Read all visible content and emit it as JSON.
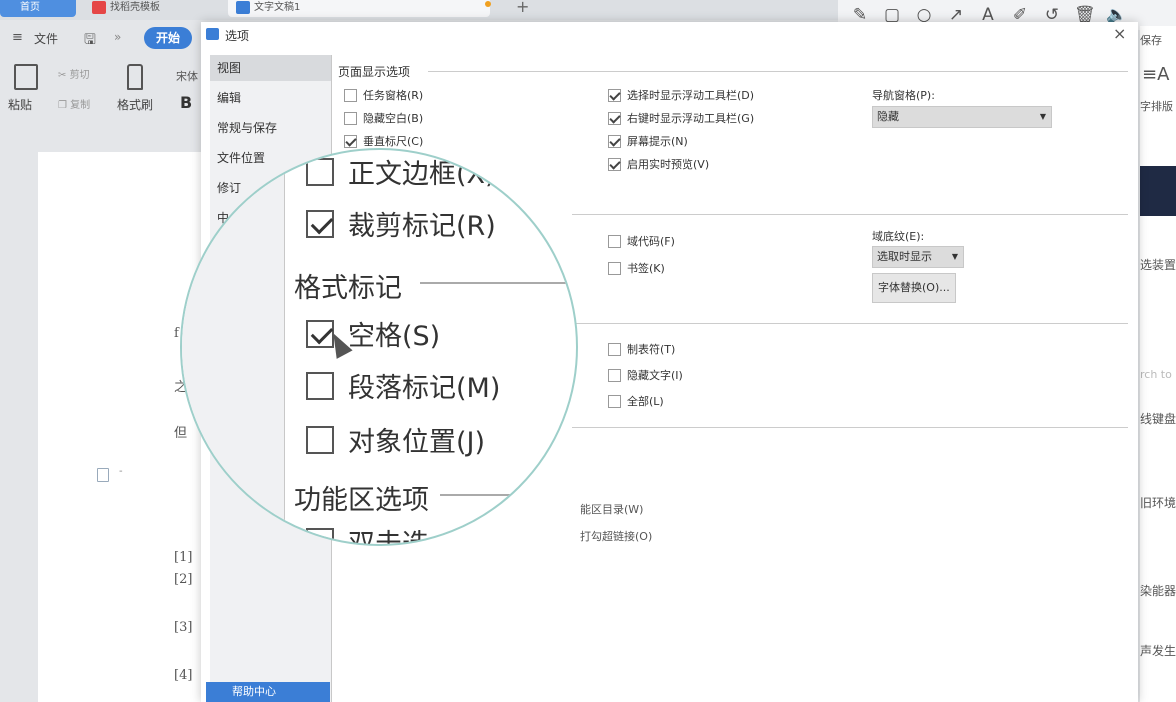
{
  "tabs": {
    "home": "首页",
    "template": "找稻壳模板",
    "doc": "文字文稿1"
  },
  "annotation_tools": [
    {
      "icon": "pencil-icon",
      "glyph": "✎"
    },
    {
      "icon": "rectangle-icon",
      "glyph": "▢"
    },
    {
      "icon": "circle-icon",
      "glyph": "○"
    },
    {
      "icon": "arrow-icon",
      "glyph": "↗"
    },
    {
      "icon": "text-icon",
      "glyph": "A"
    },
    {
      "icon": "marker-icon",
      "glyph": "✐"
    },
    {
      "icon": "undo-icon",
      "glyph": "↺"
    },
    {
      "icon": "trash-icon",
      "glyph": "🗑"
    },
    {
      "icon": "speaker-icon",
      "glyph": "🔈"
    }
  ],
  "menubar": {
    "hamburger": "≡",
    "file": "文件",
    "save_icon": "🖫",
    "more": "»",
    "start": "开始"
  },
  "ribbon": {
    "paste": "粘贴",
    "cut": "剪切",
    "copy": "复制",
    "format_painter": "格式刷",
    "font": "宋体",
    "bold": "B"
  },
  "right_strip": {
    "save": "保存",
    "char_layout_icon": "≡A",
    "char_layout": "字排版",
    "text1": "选装置",
    "search": "rch to",
    "text2": "线键盘",
    "text3": "旧环境",
    "text4": "染能器",
    "text5": "声发生"
  },
  "document": {
    "t1": "f",
    "t2": "之",
    "t3": "但",
    "refs": [
      "[1]",
      "[2]",
      "[3]",
      "[4]"
    ],
    "dash": "-"
  },
  "dialog": {
    "title": "选项",
    "close": "×",
    "nav": [
      "视图",
      "编辑",
      "常规与保存",
      "文件位置",
      "修订",
      "中"
    ],
    "help": "帮助中心",
    "page_section": "页面显示选项",
    "col1": [
      {
        "label": "任务窗格(R)",
        "checked": false
      },
      {
        "label": "隐藏空白(B)",
        "checked": false
      },
      {
        "label": "垂直标尺(C)",
        "checked": true
      }
    ],
    "col2": [
      {
        "label": "选择时显示浮动工具栏(D)",
        "checked": true
      },
      {
        "label": "右键时显示浮动工具栏(G)",
        "checked": true
      },
      {
        "label": "屏幕提示(N)",
        "checked": true
      },
      {
        "label": "启用实时预览(V)",
        "checked": true
      }
    ],
    "nav_pane_label": "导航窗格(P):",
    "nav_pane_value": "隐藏",
    "mid_col": [
      {
        "label": "域代码(F)",
        "checked": false
      },
      {
        "label": "书签(K)",
        "checked": false
      }
    ],
    "field_shading_label": "域底纹(E):",
    "field_shading_value": "选取时显示",
    "font_substitution": "字体替换(O)...",
    "format_col": [
      {
        "label": "制表符(T)",
        "checked": false
      },
      {
        "label": "隐藏文字(I)",
        "checked": false
      },
      {
        "label": "全部(L)",
        "checked": false
      }
    ],
    "ribbon_opt1": "双击选项卡时隐藏功能区目录(W)",
    "ribbon_opt2": "单击方框时打勾超链接(O)",
    "ribbon_opt1_visible": "能区目录(W)",
    "ribbon_opt2_visible": "打勾超链接(O)"
  },
  "magnifier": {
    "items": [
      {
        "label": "正文边框(X)",
        "checked": false
      },
      {
        "label": "裁剪标记(R)",
        "checked": true
      },
      {
        "label": "空格(S)",
        "checked": true
      },
      {
        "label": "段落标记(M)",
        "checked": false
      },
      {
        "label": "对象位置(J)",
        "checked": false
      },
      {
        "label": "双击选",
        "checked": false
      }
    ],
    "format_marks": "格式标记",
    "ribbon_options": "功能区选项"
  }
}
